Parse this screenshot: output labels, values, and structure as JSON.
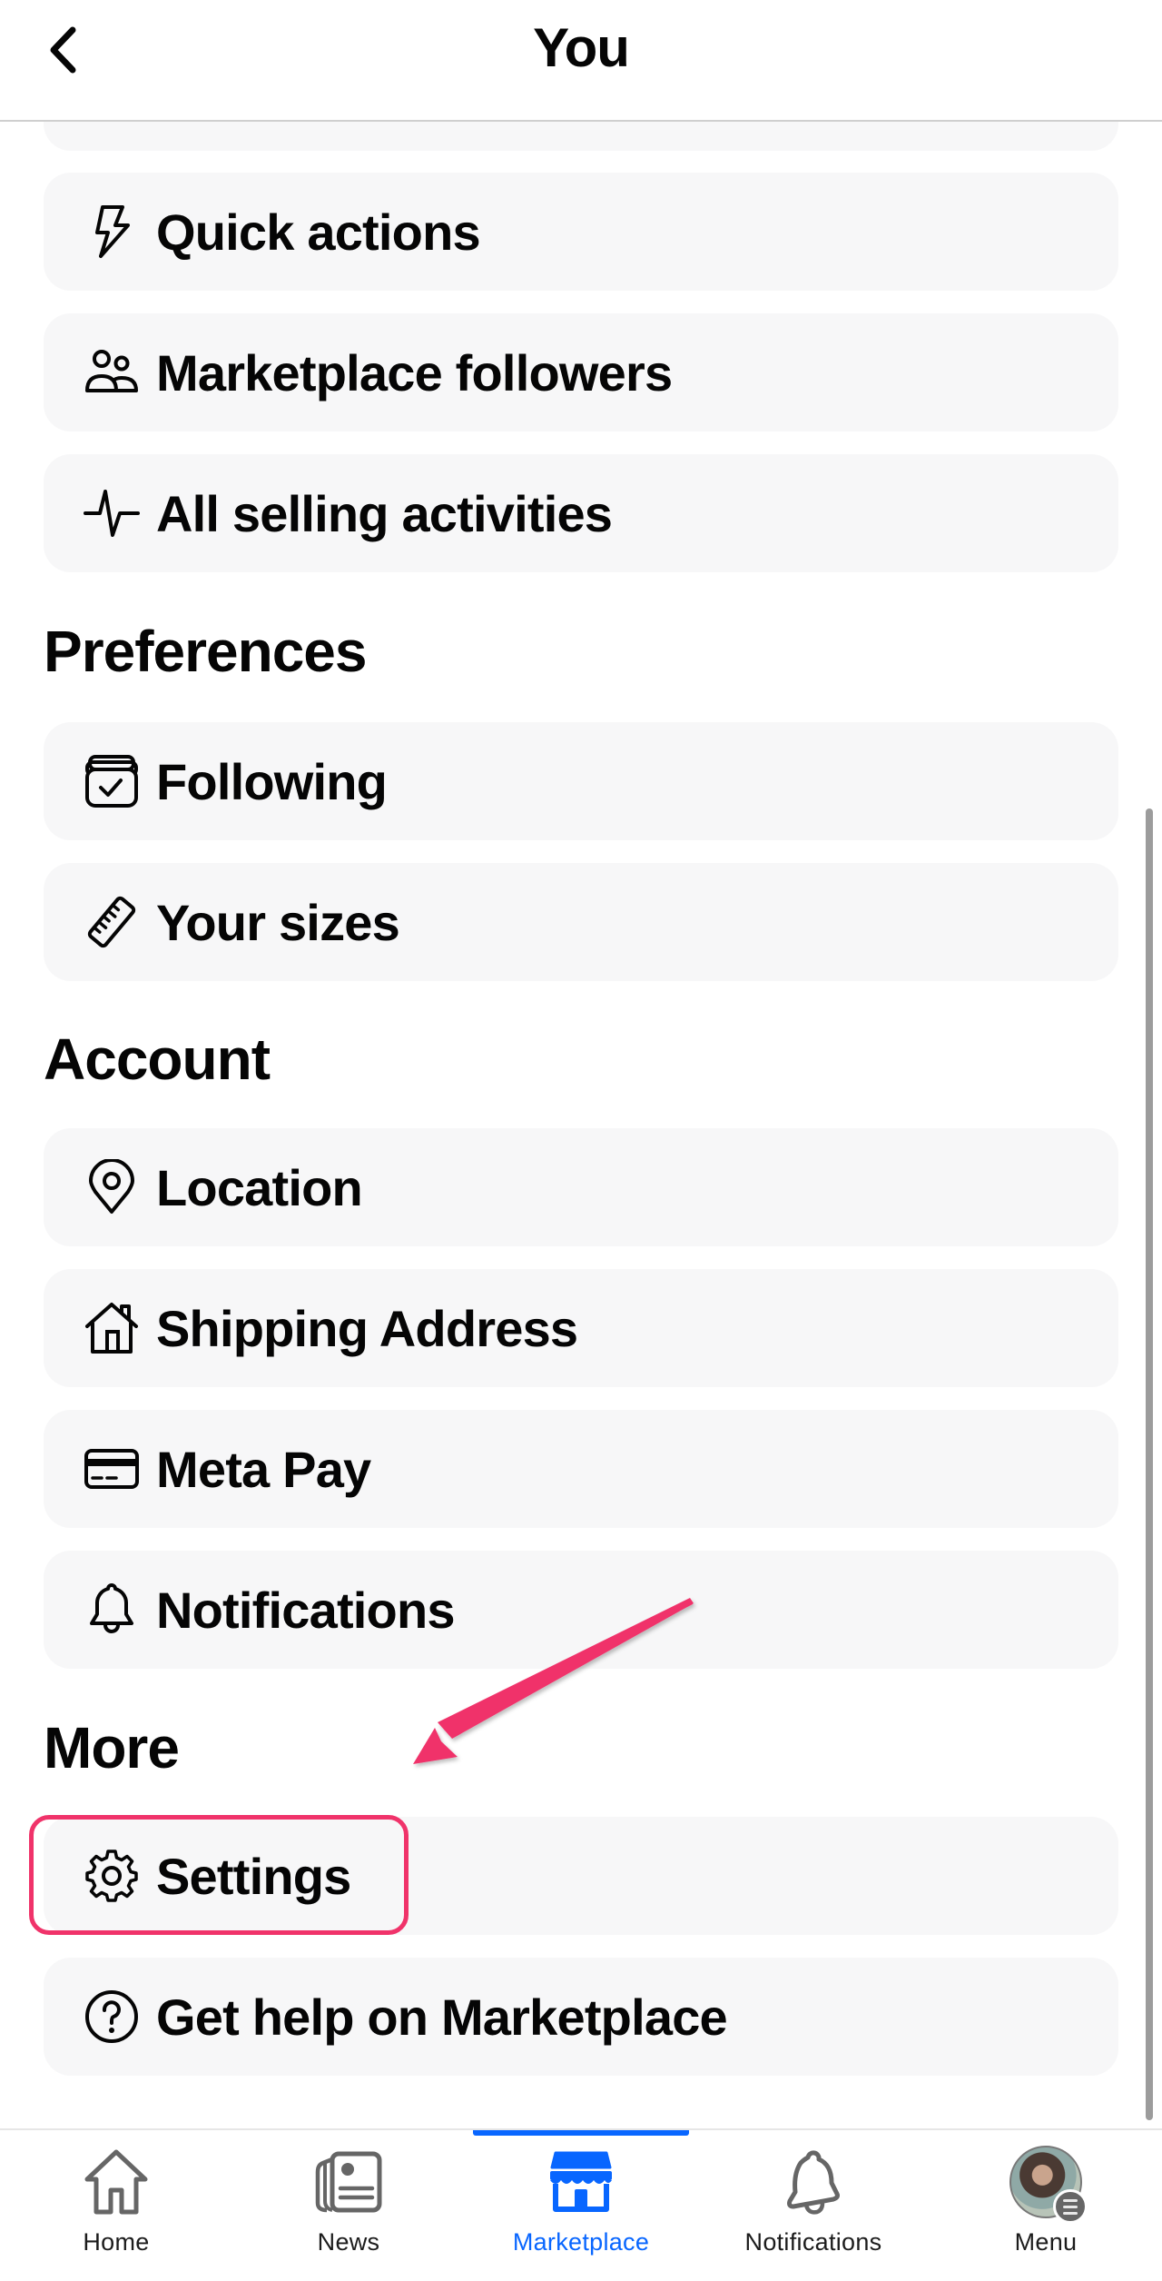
{
  "header": {
    "title": "You",
    "back_icon": "chevron-left-icon"
  },
  "sections": {
    "selling": {
      "items": [
        {
          "label": "Quick actions",
          "icon": "lightning-icon"
        },
        {
          "label": "Marketplace followers",
          "icon": "people-icon"
        },
        {
          "label": "All selling activities",
          "icon": "activity-pulse-icon"
        }
      ]
    },
    "preferences": {
      "title": "Preferences",
      "items": [
        {
          "label": "Following",
          "icon": "box-check-icon"
        },
        {
          "label": "Your sizes",
          "icon": "ruler-icon"
        }
      ]
    },
    "account": {
      "title": "Account",
      "items": [
        {
          "label": "Location",
          "icon": "location-pin-icon"
        },
        {
          "label": "Shipping Address",
          "icon": "house-icon"
        },
        {
          "label": "Meta Pay",
          "icon": "credit-card-icon"
        },
        {
          "label": "Notifications",
          "icon": "bell-icon"
        }
      ]
    },
    "more": {
      "title": "More",
      "items": [
        {
          "label": "Settings",
          "icon": "gear-icon",
          "highlighted": true
        },
        {
          "label": "Get help on Marketplace",
          "icon": "help-circle-icon"
        }
      ]
    }
  },
  "annotation": {
    "color": "#f0336a",
    "target": "Settings"
  },
  "bottom_nav": {
    "active": "Marketplace",
    "active_color": "#0866ff",
    "items": [
      {
        "label": "Home",
        "icon": "home-icon"
      },
      {
        "label": "News",
        "icon": "newspaper-icon"
      },
      {
        "label": "Marketplace",
        "icon": "storefront-icon"
      },
      {
        "label": "Notifications",
        "icon": "bell-icon"
      },
      {
        "label": "Menu",
        "icon": "avatar-menu-icon"
      }
    ]
  }
}
